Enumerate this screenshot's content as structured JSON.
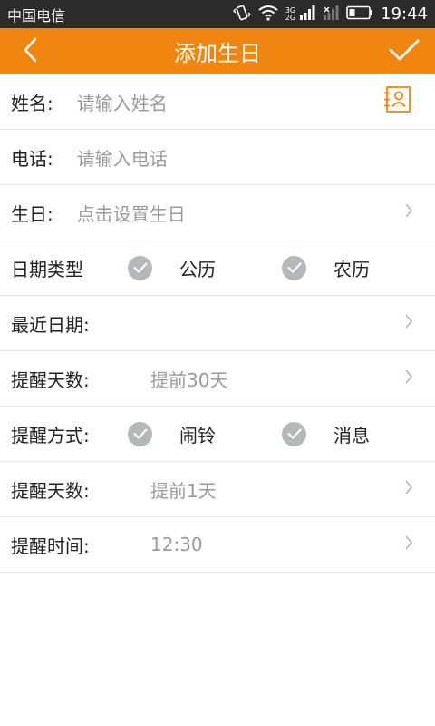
{
  "status_bar": {
    "carrier": "中国电信",
    "network_top": "3G",
    "network_bottom": "2G",
    "time": "19:44",
    "icons": [
      "vibrate-icon",
      "wifi-icon",
      "signal-icon",
      "no-signal-icon",
      "battery-icon"
    ]
  },
  "header": {
    "title": "添加生日",
    "back_icon": "back-chevron-icon",
    "confirm_icon": "checkmark-icon",
    "accent": "#f0860f"
  },
  "form": {
    "name": {
      "label": "姓名:",
      "placeholder": "请输入姓名",
      "icon": "contact-book-icon"
    },
    "phone": {
      "label": "电话:",
      "placeholder": "请输入电话"
    },
    "birthday": {
      "label": "生日:",
      "placeholder": "点击设置生日"
    },
    "date_type": {
      "label": "日期类型",
      "options": [
        {
          "label": "公历",
          "checked": true
        },
        {
          "label": "农历",
          "checked": true
        }
      ]
    },
    "recent_date": {
      "label": "最近日期:",
      "value": ""
    },
    "remind_days_1": {
      "label": "提醒天数:",
      "value": "提前30天"
    },
    "remind_method": {
      "label": "提醒方式:",
      "options": [
        {
          "label": "闹铃",
          "checked": true
        },
        {
          "label": "消息",
          "checked": true
        }
      ]
    },
    "remind_days_2": {
      "label": "提醒天数:",
      "value": "提前1天"
    },
    "remind_time": {
      "label": "提醒时间:",
      "value": "12:30"
    }
  },
  "colors": {
    "check_bg": "#b5b8b8",
    "divider": "#e4e4e4",
    "placeholder": "#9a9a9a"
  }
}
